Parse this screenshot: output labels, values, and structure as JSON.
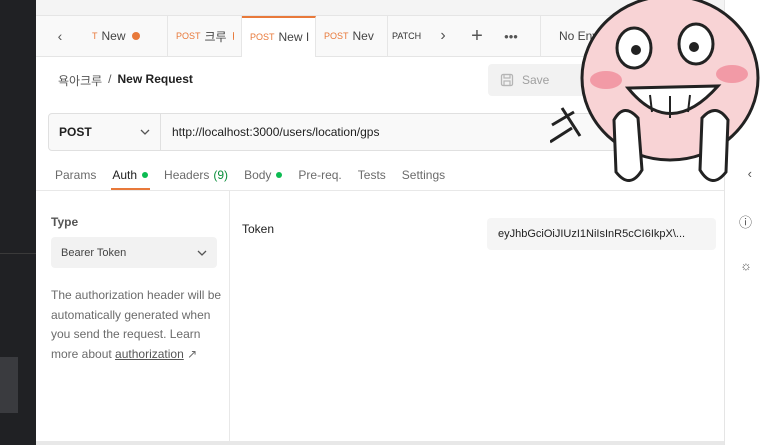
{
  "tabs": [
    {
      "method": "T",
      "name": "New",
      "dirty": true,
      "active": false
    },
    {
      "method": "POST",
      "name": "크루",
      "dirty": true,
      "active": false
    },
    {
      "method": "POST",
      "name": "New I",
      "dirty": false,
      "active": true
    },
    {
      "method": "POST",
      "name": "Nev",
      "dirty": true,
      "active": false
    },
    {
      "method": "PATCH",
      "name": "",
      "dirty": false,
      "active": false
    }
  ],
  "environment": "No Envi",
  "breadcrumb": {
    "parent": "욕아크루",
    "sep": "/",
    "current": "New Request"
  },
  "save_label": "Save",
  "request": {
    "method": "POST",
    "url": "http://localhost:3000/users/location/gps"
  },
  "subtabs": {
    "params": "Params",
    "auth": "Auth",
    "headers": "Headers",
    "headers_count": "(9)",
    "body": "Body",
    "prereq": "Pre-req.",
    "tests": "Tests",
    "settings": "Settings"
  },
  "auth": {
    "type_label": "Type",
    "type_value": "Bearer Token",
    "description": "The authorization header will be automatically generated when you send the request. Learn more about",
    "link_text": "authorization",
    "link_arrow": "↗",
    "token_label": "Token",
    "token_value": "eyJhbGciOiJIUzI1NiIsInR5cCI6IkpX\\..."
  },
  "colors": {
    "accent": "#e8793a",
    "green": "#0cbb52"
  }
}
